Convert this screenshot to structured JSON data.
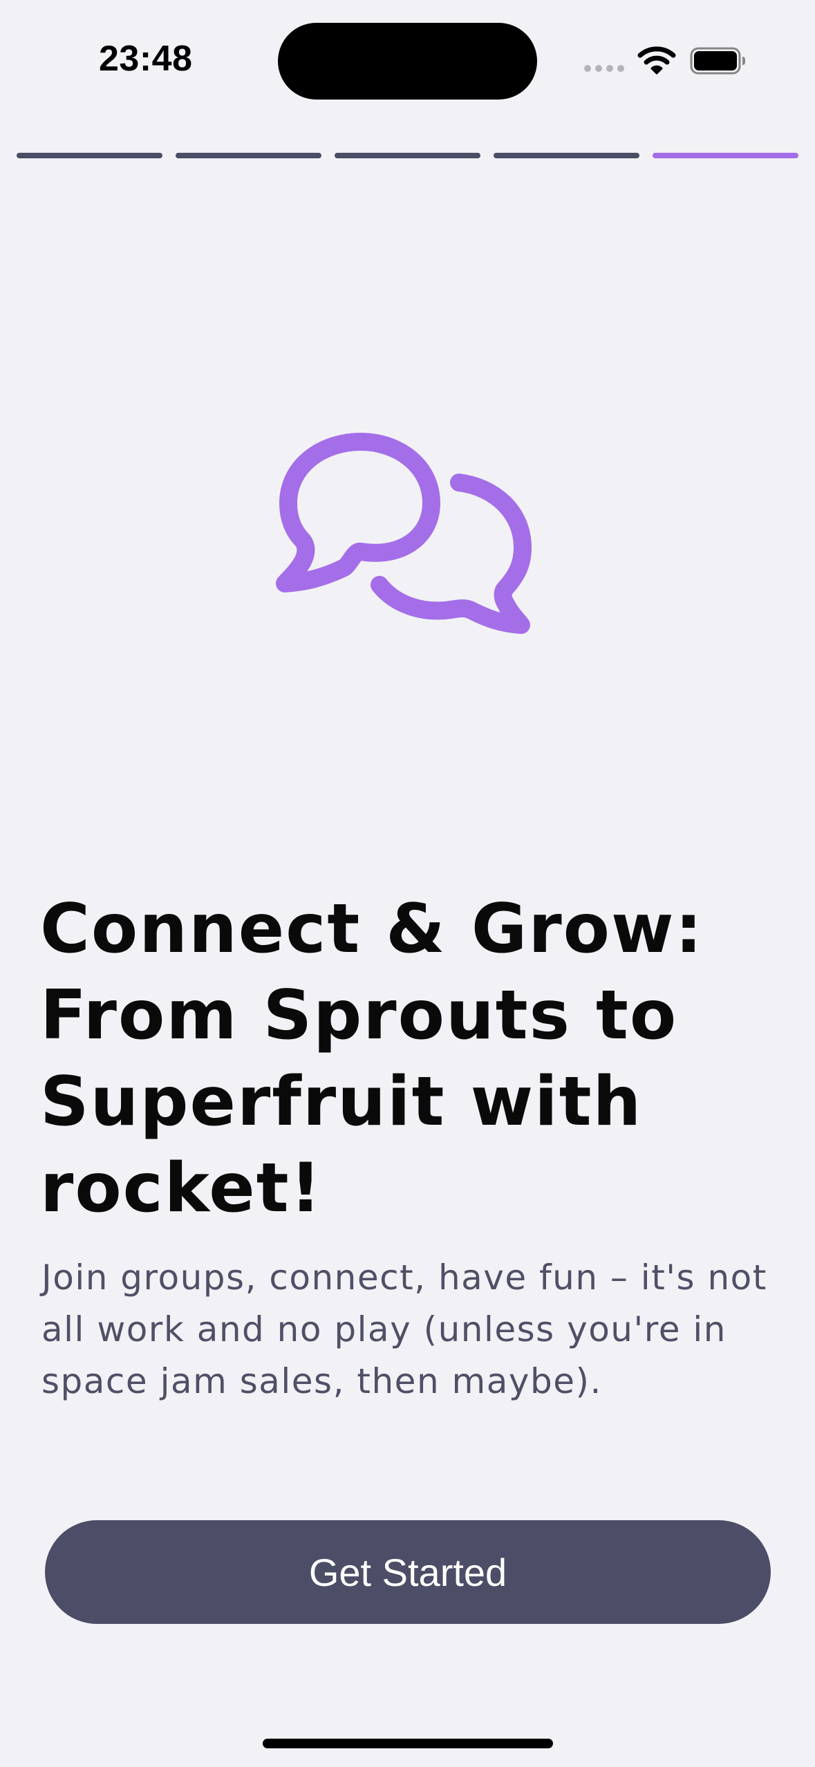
{
  "status_bar": {
    "time": "23:48",
    "icons": [
      "cell-signal-icon",
      "wifi-icon",
      "battery-icon"
    ]
  },
  "onboarding": {
    "total_steps": 5,
    "current_step": 5
  },
  "hero_icon": "chat-bubbles-icon",
  "headline": "Connect & Grow: From Sprouts to Superfruit with rocket!",
  "subtitle": "Join groups, connect, have fun – it's not all work and no play (unless you're in space jam sales, then maybe).",
  "cta_label": "Get Started",
  "colors": {
    "background": "#f2f2f6",
    "accent": "#a46ee8",
    "primary": "#4c4d66",
    "subtitle": "#4f4f66"
  }
}
